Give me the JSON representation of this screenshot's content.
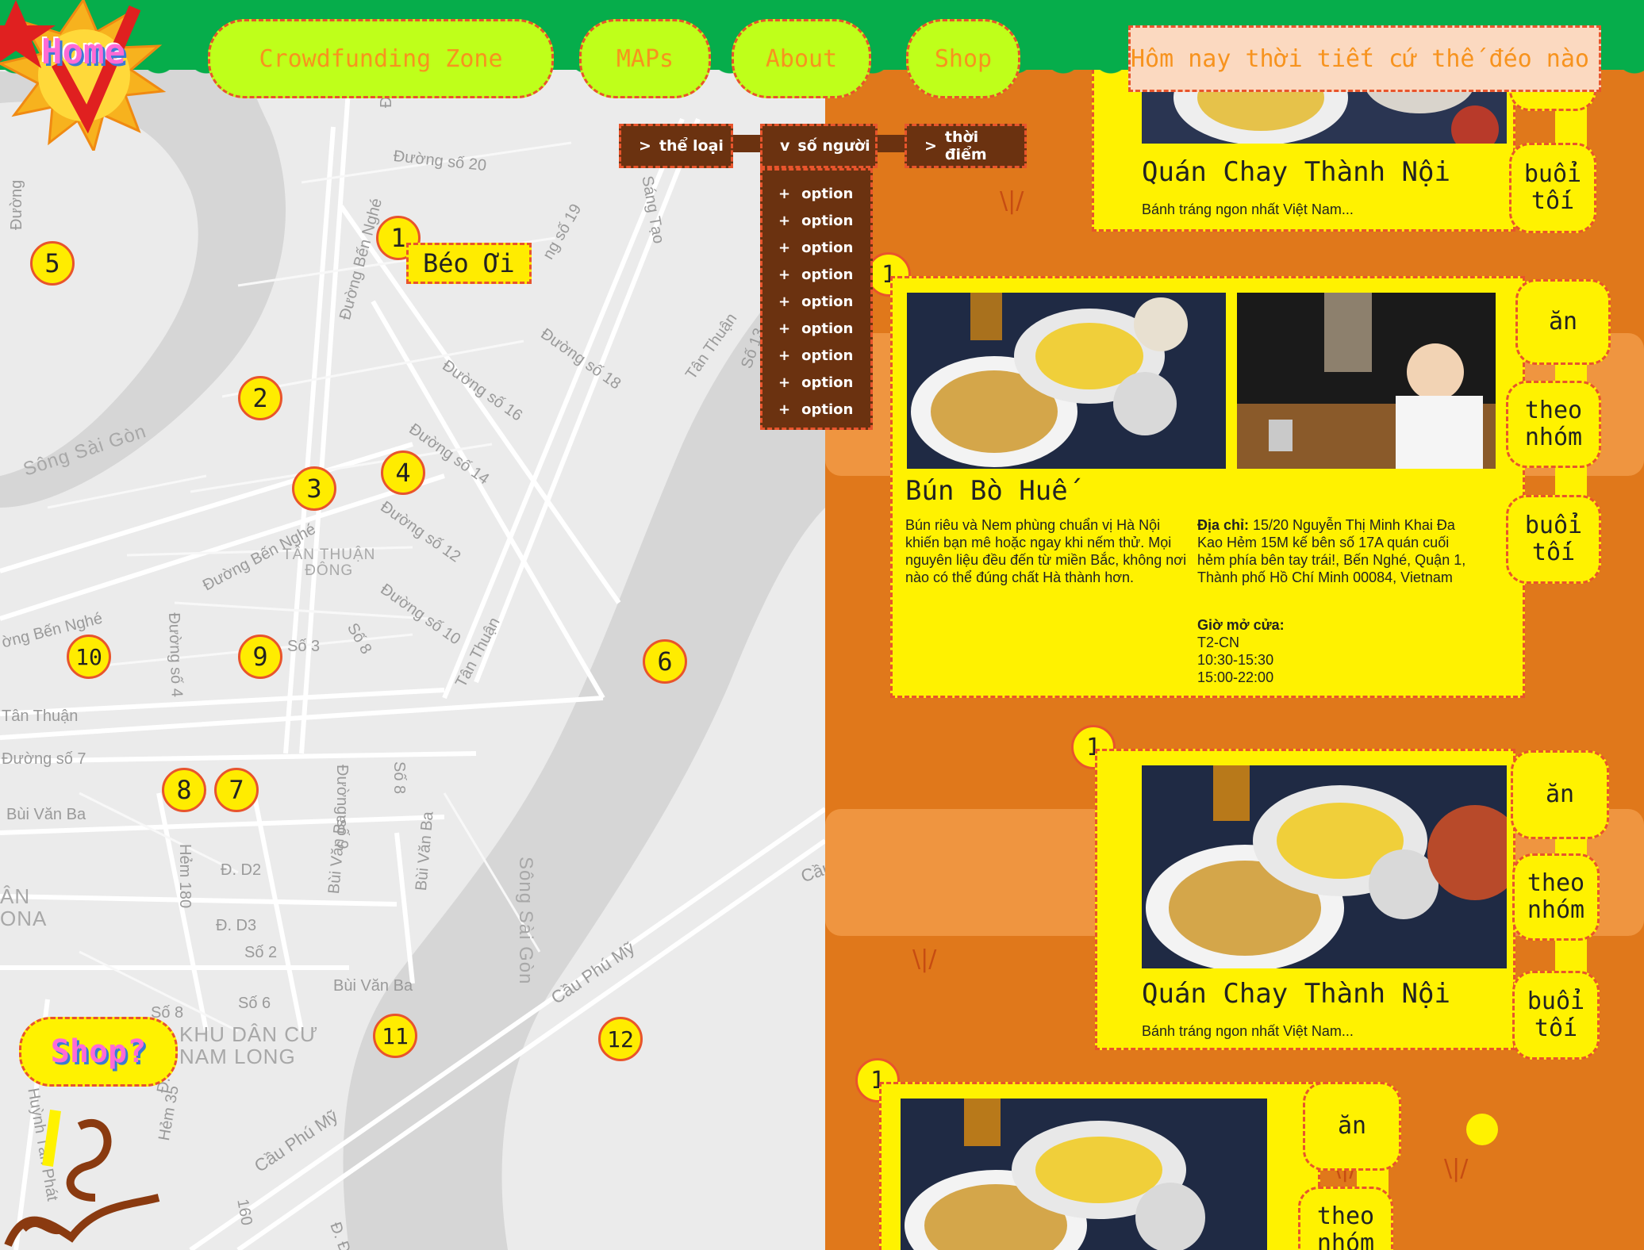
{
  "nav": {
    "home": "Home",
    "items": [
      {
        "label": "Crowdfunding Zone"
      },
      {
        "label": "MAPs"
      },
      {
        "label": "About"
      },
      {
        "label": "Shop"
      }
    ],
    "weather": "Hôm nay thời tiết cứ thế đéo nào"
  },
  "map": {
    "labels": {
      "d20": "Đường số 20",
      "d19": "ng số 19",
      "sangtao": "Sáng Tạo",
      "d18": "Đường số 18",
      "tanthuan1": "Tân Thuận",
      "s13": "Số 13",
      "d16": "Đường số 16",
      "d14": "Đường số 14",
      "d12": "Đường số 12",
      "d10": "Đường số 10",
      "benghe1": "Đường Bến Nghé",
      "benghe2": "Đường Bến Nghé",
      "benghe3": "ờng Bến Nghé",
      "tanthuandong": "TÂN THUẬN\nĐÔNG",
      "song1": "Sông Sài Gòn",
      "song2": "Sông Sài Gòn",
      "so3": "Số 3",
      "so8": "Số 8",
      "tanthuan2": "Tân Thuận",
      "tanthuan3": "Tân Thuận",
      "d4": "Đường số 4",
      "d7": "Đường số 7",
      "buivanba1": "Bùi Văn Ba",
      "buivanba2": "Bùi Văn Ba",
      "buivanba3": "Bùi Văn Ba",
      "buivanba4": "Bùi Văn Ba",
      "d9": "Đường số 9",
      "so8b": "Số 8",
      "hem180": "Hẻm 180",
      "dd2": "Đ. D2",
      "dd3": "Đ. D3",
      "so2": "Số 2",
      "so6": "Số 6",
      "so8c": "Số 8",
      "khudancu": "KHU DÂN CƯ\nNAM LONG",
      "an": "ÂN\nONA",
      "cauphumy1": "Cầu Phú Mỹ",
      "cauphumy2": "Cầu Phú Mỹ",
      "cau": "Cầu",
      "huynhtan": "Huỳnh Tấn Phát",
      "hem35": "Hẻm 35",
      "d7b": "Đ. Số 7",
      "n160": "160",
      "ddao": "Đ. Đào",
      "duong": "Đườ",
      "duong2": "Đường"
    },
    "markers": [
      "1",
      "2",
      "3",
      "4",
      "5",
      "6",
      "7",
      "8",
      "9",
      "10",
      "11",
      "12"
    ],
    "popup": "Béo Ơi"
  },
  "filters": {
    "category": "thể loại",
    "people": "số người",
    "time": "thời điểm",
    "options": [
      "option",
      "option",
      "option",
      "option",
      "option",
      "option",
      "option",
      "option",
      "option"
    ]
  },
  "cards": [
    {
      "num": "1",
      "title": "Quán Chay Thành Nội",
      "desc": "Bánh tráng ngon nhất Việt Nam...",
      "tags": [
        "buổi tối"
      ]
    },
    {
      "num": "1",
      "title": "Bún Bò Huế",
      "desc": "Bún riêu và Nem phùng chuẩn vị Hà Nội khiến bạn mê hoặc ngay khi nếm thử. Mọi nguyên liệu đều đến từ miền Bắc, không nơi nào có thể đúng chất Hà thành hơn.",
      "address_label": "Địa chỉ:",
      "address": " 15/20 Nguyễn Thị Minh Khai Đa Kao Hẻm 15M kế bên số 17A quán cuối hẻm phía bên tay trái!, Bến Nghé, Quận 1, Thành phố Hồ Chí Minh 00084, Vietnam",
      "hours_label": "Giờ mở cửa:",
      "hours": [
        "T2-CN",
        "10:30-15:30",
        "15:00-22:00"
      ],
      "tags": [
        "ăn",
        "theo nhóm",
        "buổi tối"
      ]
    },
    {
      "num": "1",
      "title": "Quán Chay Thành Nội",
      "desc": "Bánh tráng ngon nhất Việt Nam...",
      "tags": [
        "ăn",
        "theo nhóm",
        "buổi tối"
      ]
    },
    {
      "num": "1",
      "tags": [
        "ăn",
        "theo nhóm"
      ]
    }
  ],
  "shop_bubble": "Shop?",
  "colors": {
    "nav_green": "#06ad4b",
    "nav_button": "#bfff1a",
    "accent_orange": "#f7931e",
    "card_yellow": "#fff200",
    "dashed_border": "#e8542c",
    "filter_brown": "#6b3210",
    "background_orange": "#e0781b"
  }
}
